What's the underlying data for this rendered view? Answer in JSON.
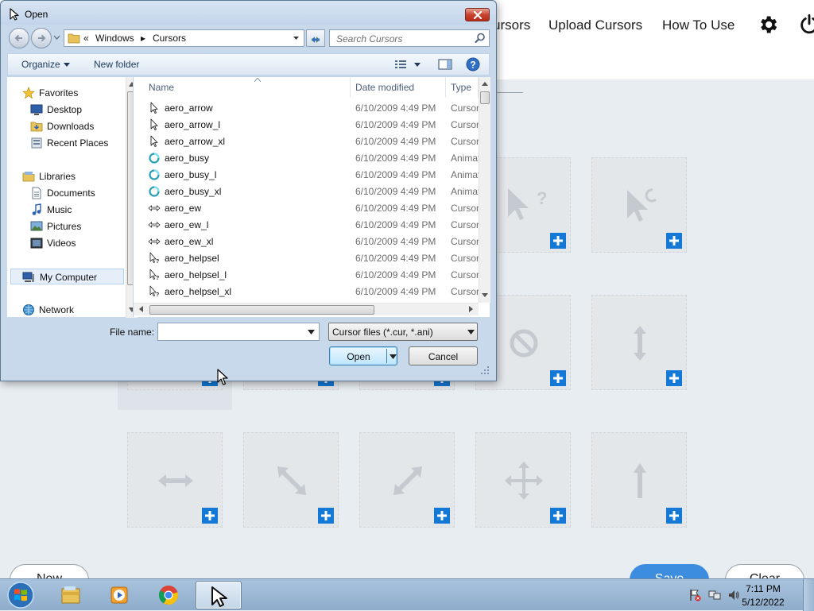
{
  "app": {
    "nav": [
      {
        "id": "my-cursors",
        "label": "ursors"
      },
      {
        "id": "upload-cursors",
        "label": "Upload Cursors"
      },
      {
        "id": "how-to-use",
        "label": "How To Use"
      }
    ],
    "icons": {
      "settings": "gear-icon",
      "power": "power-icon"
    },
    "tiles": [
      {
        "row": 0,
        "col": 3,
        "glyph": "help-cursor"
      },
      {
        "row": 0,
        "col": 4,
        "glyph": "busy-cursor"
      },
      {
        "row": 1,
        "col": 0,
        "glyph": "none"
      },
      {
        "row": 1,
        "col": 1,
        "glyph": "none"
      },
      {
        "row": 1,
        "col": 2,
        "glyph": "none"
      },
      {
        "row": 1,
        "col": 3,
        "glyph": "no-cursor"
      },
      {
        "row": 1,
        "col": 4,
        "glyph": "ns-resize"
      },
      {
        "row": 2,
        "col": 0,
        "glyph": "ew-resize"
      },
      {
        "row": 2,
        "col": 1,
        "glyph": "nwse-resize"
      },
      {
        "row": 2,
        "col": 2,
        "glyph": "nesw-resize"
      },
      {
        "row": 2,
        "col": 3,
        "glyph": "move"
      },
      {
        "row": 2,
        "col": 4,
        "glyph": "up-arrow"
      }
    ],
    "buttons": {
      "new": "New",
      "save": "Save",
      "clear": "Clear"
    },
    "colors": {
      "accent": "#1479d6",
      "save_bg": "#3c8de0"
    }
  },
  "dialog": {
    "title": "Open",
    "breadcrumb": {
      "prefix": "«",
      "segments": [
        "Windows",
        "Cursors"
      ]
    },
    "search_placeholder": "Search Cursors",
    "toolbar": {
      "organize": "Organize",
      "new_folder": "New folder"
    },
    "nav_pane": {
      "favorites": {
        "label": "Favorites",
        "items": [
          "Desktop",
          "Downloads",
          "Recent Places"
        ]
      },
      "libraries": {
        "label": "Libraries",
        "items": [
          "Documents",
          "Music",
          "Pictures",
          "Videos"
        ]
      },
      "computer": "My Computer",
      "network": "Network"
    },
    "columns": {
      "name": "Name",
      "date": "Date modified",
      "type": "Type"
    },
    "files": [
      {
        "name": "aero_arrow",
        "date": "6/10/2009 4:49 PM",
        "type": "Cursor",
        "icon": "arrow"
      },
      {
        "name": "aero_arrow_l",
        "date": "6/10/2009 4:49 PM",
        "type": "Cursor",
        "icon": "arrow"
      },
      {
        "name": "aero_arrow_xl",
        "date": "6/10/2009 4:49 PM",
        "type": "Cursor",
        "icon": "arrow"
      },
      {
        "name": "aero_busy",
        "date": "6/10/2009 4:49 PM",
        "type": "Animated",
        "icon": "busy"
      },
      {
        "name": "aero_busy_l",
        "date": "6/10/2009 4:49 PM",
        "type": "Animated",
        "icon": "busy"
      },
      {
        "name": "aero_busy_xl",
        "date": "6/10/2009 4:49 PM",
        "type": "Animated",
        "icon": "busy"
      },
      {
        "name": "aero_ew",
        "date": "6/10/2009 4:49 PM",
        "type": "Cursor",
        "icon": "ew"
      },
      {
        "name": "aero_ew_l",
        "date": "6/10/2009 4:49 PM",
        "type": "Cursor",
        "icon": "ew"
      },
      {
        "name": "aero_ew_xl",
        "date": "6/10/2009 4:49 PM",
        "type": "Cursor",
        "icon": "ew"
      },
      {
        "name": "aero_helpsel",
        "date": "6/10/2009 4:49 PM",
        "type": "Cursor",
        "icon": "help"
      },
      {
        "name": "aero_helpsel_l",
        "date": "6/10/2009 4:49 PM",
        "type": "Cursor",
        "icon": "help"
      },
      {
        "name": "aero_helpsel_xl",
        "date": "6/10/2009 4:49 PM",
        "type": "Cursor",
        "icon": "help"
      }
    ],
    "filename_label": "File name:",
    "filename_value": "",
    "filter": "Cursor files (*.cur, *.ani)",
    "open_button": "Open",
    "cancel_button": "Cancel"
  },
  "taskbar": {
    "apps": [
      "windows-explorer",
      "media-player",
      "chrome",
      "cursor-app"
    ],
    "active_app": "cursor-app",
    "time": "7:11 PM",
    "date": "5/12/2022"
  }
}
